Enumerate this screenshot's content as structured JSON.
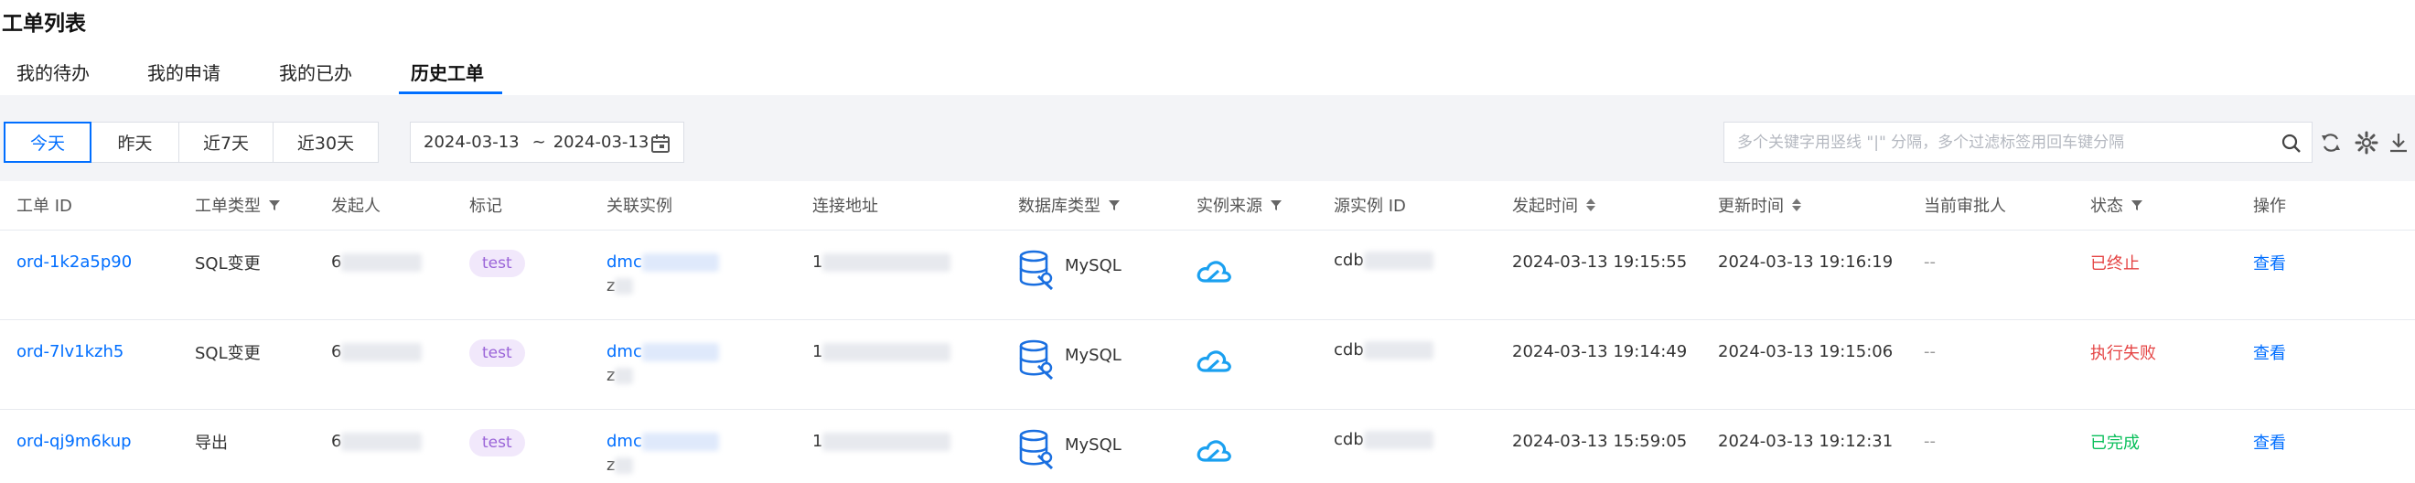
{
  "page_title": "工单列表",
  "tabs": [
    {
      "label": "我的待办"
    },
    {
      "label": "我的申请"
    },
    {
      "label": "我的已办"
    },
    {
      "label": "历史工单"
    }
  ],
  "active_tab": "历史工单",
  "time_filters": [
    "今天",
    "昨天",
    "近7天",
    "近30天"
  ],
  "active_time_filter": "今天",
  "date_range": {
    "start": "2024-03-13",
    "separator": "~",
    "end": "2024-03-13"
  },
  "search": {
    "placeholder": "多个关键字用竖线 \"|\" 分隔，多个过滤标签用回车键分隔",
    "value": ""
  },
  "columns": [
    "工单 ID",
    "工单类型",
    "发起人",
    "标记",
    "关联实例",
    "连接地址",
    "数据库类型",
    "实例来源",
    "源实例 ID",
    "发起时间",
    "更新时间",
    "当前审批人",
    "状态",
    "操作"
  ],
  "rows": [
    {
      "id": "ord-1k2a5p90",
      "type": "SQL变更",
      "initiator": "6",
      "tag": "test",
      "instance_line1": "dmc",
      "instance_line2": "z",
      "address": "1",
      "db_type": "MySQL",
      "source_instance": "cdb",
      "created": "2024-03-13 19:15:55",
      "updated": "2024-03-13 19:16:19",
      "approver": "--",
      "status": "已终止",
      "status_color": "#e54545",
      "action": "查看"
    },
    {
      "id": "ord-7lv1kzh5",
      "type": "SQL变更",
      "initiator": "6",
      "tag": "test",
      "instance_line1": "dmc",
      "instance_line2": "z",
      "address": "1",
      "db_type": "MySQL",
      "source_instance": "cdb",
      "created": "2024-03-13 19:14:49",
      "updated": "2024-03-13 19:15:06",
      "approver": "--",
      "status": "执行失败",
      "status_color": "#e54545",
      "action": "查看"
    },
    {
      "id": "ord-qj9m6kup",
      "type": "导出",
      "initiator": "6",
      "tag": "test",
      "instance_line1": "dmc",
      "instance_line2": "z",
      "address": "1",
      "db_type": "MySQL",
      "source_instance": "cdb",
      "created": "2024-03-13 15:59:05",
      "updated": "2024-03-13 19:12:31",
      "approver": "--",
      "status": "已完成",
      "status_color": "#0abf5b",
      "action": "查看"
    }
  ],
  "colors": {
    "accent": "#006eff",
    "danger": "#e54545",
    "success": "#0abf5b",
    "tag_bg": "#f1e8fb",
    "tag_text": "#9a64d8"
  }
}
